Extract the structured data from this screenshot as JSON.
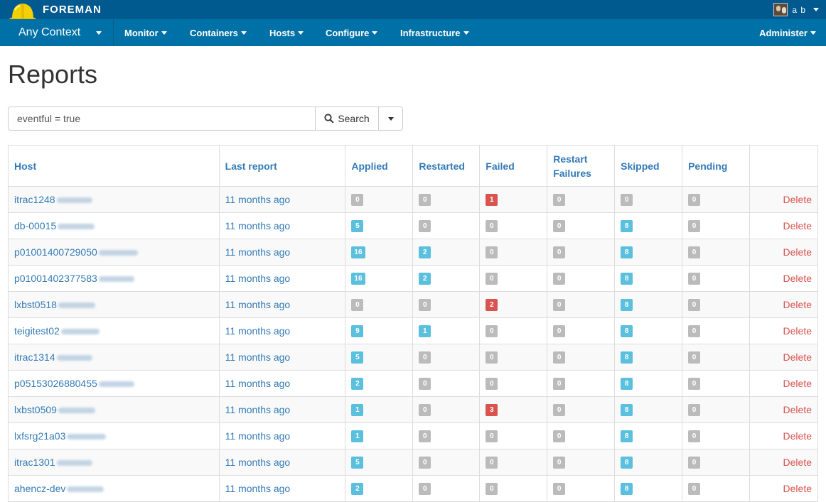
{
  "brand": {
    "name": "FOREMAN"
  },
  "user": {
    "name": "a b"
  },
  "nav": {
    "context": "Any Context",
    "items": [
      "Monitor",
      "Containers",
      "Hosts",
      "Configure",
      "Infrastructure"
    ],
    "administer": "Administer"
  },
  "page": {
    "title": "Reports"
  },
  "search": {
    "value": "eventful = true",
    "button_label": "Search"
  },
  "table": {
    "headers": {
      "host": "Host",
      "last_report": "Last report",
      "applied": "Applied",
      "restarted": "Restarted",
      "failed": "Failed",
      "restart_failures": "Restart Failures",
      "skipped": "Skipped",
      "pending": "Pending"
    },
    "delete_label": "Delete",
    "rows": [
      {
        "host": "itrac1248",
        "last": "11 months ago",
        "applied": "0",
        "restarted": "0",
        "failed": "1",
        "restart_failures": "0",
        "skipped": "0",
        "pending": "0"
      },
      {
        "host": "db-00015",
        "last": "11 months ago",
        "applied": "5",
        "restarted": "0",
        "failed": "0",
        "restart_failures": "0",
        "skipped": "8",
        "pending": "0"
      },
      {
        "host": "p01001400729050",
        "last": "11 months ago",
        "applied": "16",
        "restarted": "2",
        "failed": "0",
        "restart_failures": "0",
        "skipped": "8",
        "pending": "0"
      },
      {
        "host": "p01001402377583",
        "last": "11 months ago",
        "applied": "16",
        "restarted": "2",
        "failed": "0",
        "restart_failures": "0",
        "skipped": "8",
        "pending": "0"
      },
      {
        "host": "lxbst0518",
        "last": "11 months ago",
        "applied": "0",
        "restarted": "0",
        "failed": "2",
        "restart_failures": "0",
        "skipped": "8",
        "pending": "0"
      },
      {
        "host": "teigitest02",
        "last": "11 months ago",
        "applied": "9",
        "restarted": "1",
        "failed": "0",
        "restart_failures": "0",
        "skipped": "8",
        "pending": "0"
      },
      {
        "host": "itrac1314",
        "last": "11 months ago",
        "applied": "5",
        "restarted": "0",
        "failed": "0",
        "restart_failures": "0",
        "skipped": "8",
        "pending": "0"
      },
      {
        "host": "p05153026880455",
        "last": "11 months ago",
        "applied": "2",
        "restarted": "0",
        "failed": "0",
        "restart_failures": "0",
        "skipped": "8",
        "pending": "0"
      },
      {
        "host": "lxbst0509",
        "last": "11 months ago",
        "applied": "1",
        "restarted": "0",
        "failed": "3",
        "restart_failures": "0",
        "skipped": "8",
        "pending": "0"
      },
      {
        "host": "lxfsrg21a03",
        "last": "11 months ago",
        "applied": "1",
        "restarted": "0",
        "failed": "0",
        "restart_failures": "0",
        "skipped": "8",
        "pending": "0"
      },
      {
        "host": "itrac1301",
        "last": "11 months ago",
        "applied": "5",
        "restarted": "0",
        "failed": "0",
        "restart_failures": "0",
        "skipped": "8",
        "pending": "0"
      },
      {
        "host": "ahencz-dev",
        "last": "11 months ago",
        "applied": "2",
        "restarted": "0",
        "failed": "0",
        "restart_failures": "0",
        "skipped": "8",
        "pending": "0"
      }
    ]
  },
  "colors": {
    "brand_bar": "#00598f",
    "nav_bar": "#0071a6",
    "link": "#337ab7",
    "badge_default": "#bbbbbb",
    "badge_info": "#5bc0de",
    "badge_danger": "#d9534f",
    "delete": "#d9534f"
  }
}
